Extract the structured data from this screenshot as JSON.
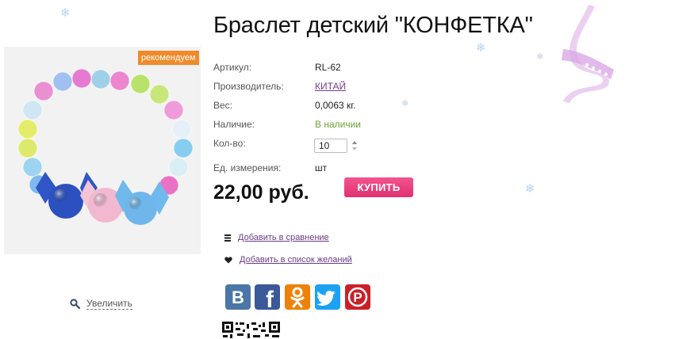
{
  "product": {
    "title": "Браслет детский \"КОНФЕТКА\"",
    "badge": "рекомендуем",
    "zoom_label": "Увеличить",
    "price": "22,00 руб.",
    "buy_label": "КУПИТЬ",
    "specs": {
      "article_label": "Артикул:",
      "article_value": "RL-62",
      "maker_label": "Производитель:",
      "maker_value": "КИТАЙ",
      "weight_label": "Вес:",
      "weight_value": "0,0063 кг.",
      "availability_label": "Наличие:",
      "availability_value": "В наличии",
      "qty_label": "Кол-во:",
      "qty_value": "10",
      "unit_label": "Ед. измерения:",
      "unit_value": "шт"
    }
  },
  "actions": {
    "compare_label": "Добавить в сравнение",
    "wishlist_label": "Добавить в список желаний"
  },
  "social": [
    {
      "name": "vk",
      "letter": "В",
      "color": "#4a76a8"
    },
    {
      "name": "facebook",
      "letter": "f",
      "color": "#3b5998"
    },
    {
      "name": "odnoklassniki",
      "letter": "ок",
      "color": "#ee8208"
    },
    {
      "name": "twitter",
      "letter": "t",
      "color": "#1da1f2"
    },
    {
      "name": "pinterest",
      "letter": "P",
      "color": "#cb2027"
    }
  ],
  "colors": {
    "badge": "#f08a2a",
    "buy_button": "#e8417d",
    "in_stock": "#6aa32e",
    "link": "#7a3e8c"
  }
}
